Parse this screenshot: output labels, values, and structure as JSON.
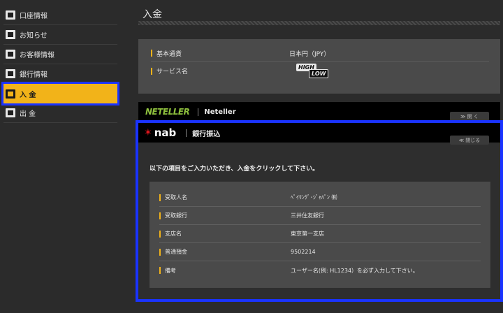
{
  "sidebar": {
    "items": [
      {
        "label": "口座情報"
      },
      {
        "label": "お知らせ"
      },
      {
        "label": "お客様情報"
      },
      {
        "label": "銀行情報"
      },
      {
        "label": "入 金"
      },
      {
        "label": "出 金"
      }
    ]
  },
  "main": {
    "title": "入金",
    "info": {
      "rows": [
        {
          "label": "基本通貨",
          "value": "日本円（JPY）"
        },
        {
          "label": "サービス名",
          "value": ""
        }
      ],
      "logo_high": "HIGH",
      "logo_low": "LOW"
    },
    "neteller": {
      "logo": "NETELLER",
      "name": "Neteller",
      "toggle": "≫ 開 く"
    },
    "bank": {
      "logo": "nab",
      "name": "銀行振込",
      "toggle": "≪ 閉じる",
      "instruction": "以下の項目をご入力いただき、入金をクリックして下さい。",
      "rows": [
        {
          "label": "受取人名",
          "value": "ﾍﾟｲﾘﾝｸﾞ･ｼﾞｬﾊﾟﾝ ㈲"
        },
        {
          "label": "受取銀行",
          "value": "三井住友銀行"
        },
        {
          "label": "支店名",
          "value": "東京第一支店"
        },
        {
          "label": "普通預金",
          "value": "9502214"
        },
        {
          "label": "備考",
          "value": "ユーザー名(例: HL1234）を必ず入力して下さい。"
        }
      ]
    }
  },
  "colors": {
    "accent": "#f2b319",
    "highlight": "#1a33ff",
    "neteller_green": "#8fc13e",
    "nab_red": "#e4161d"
  }
}
